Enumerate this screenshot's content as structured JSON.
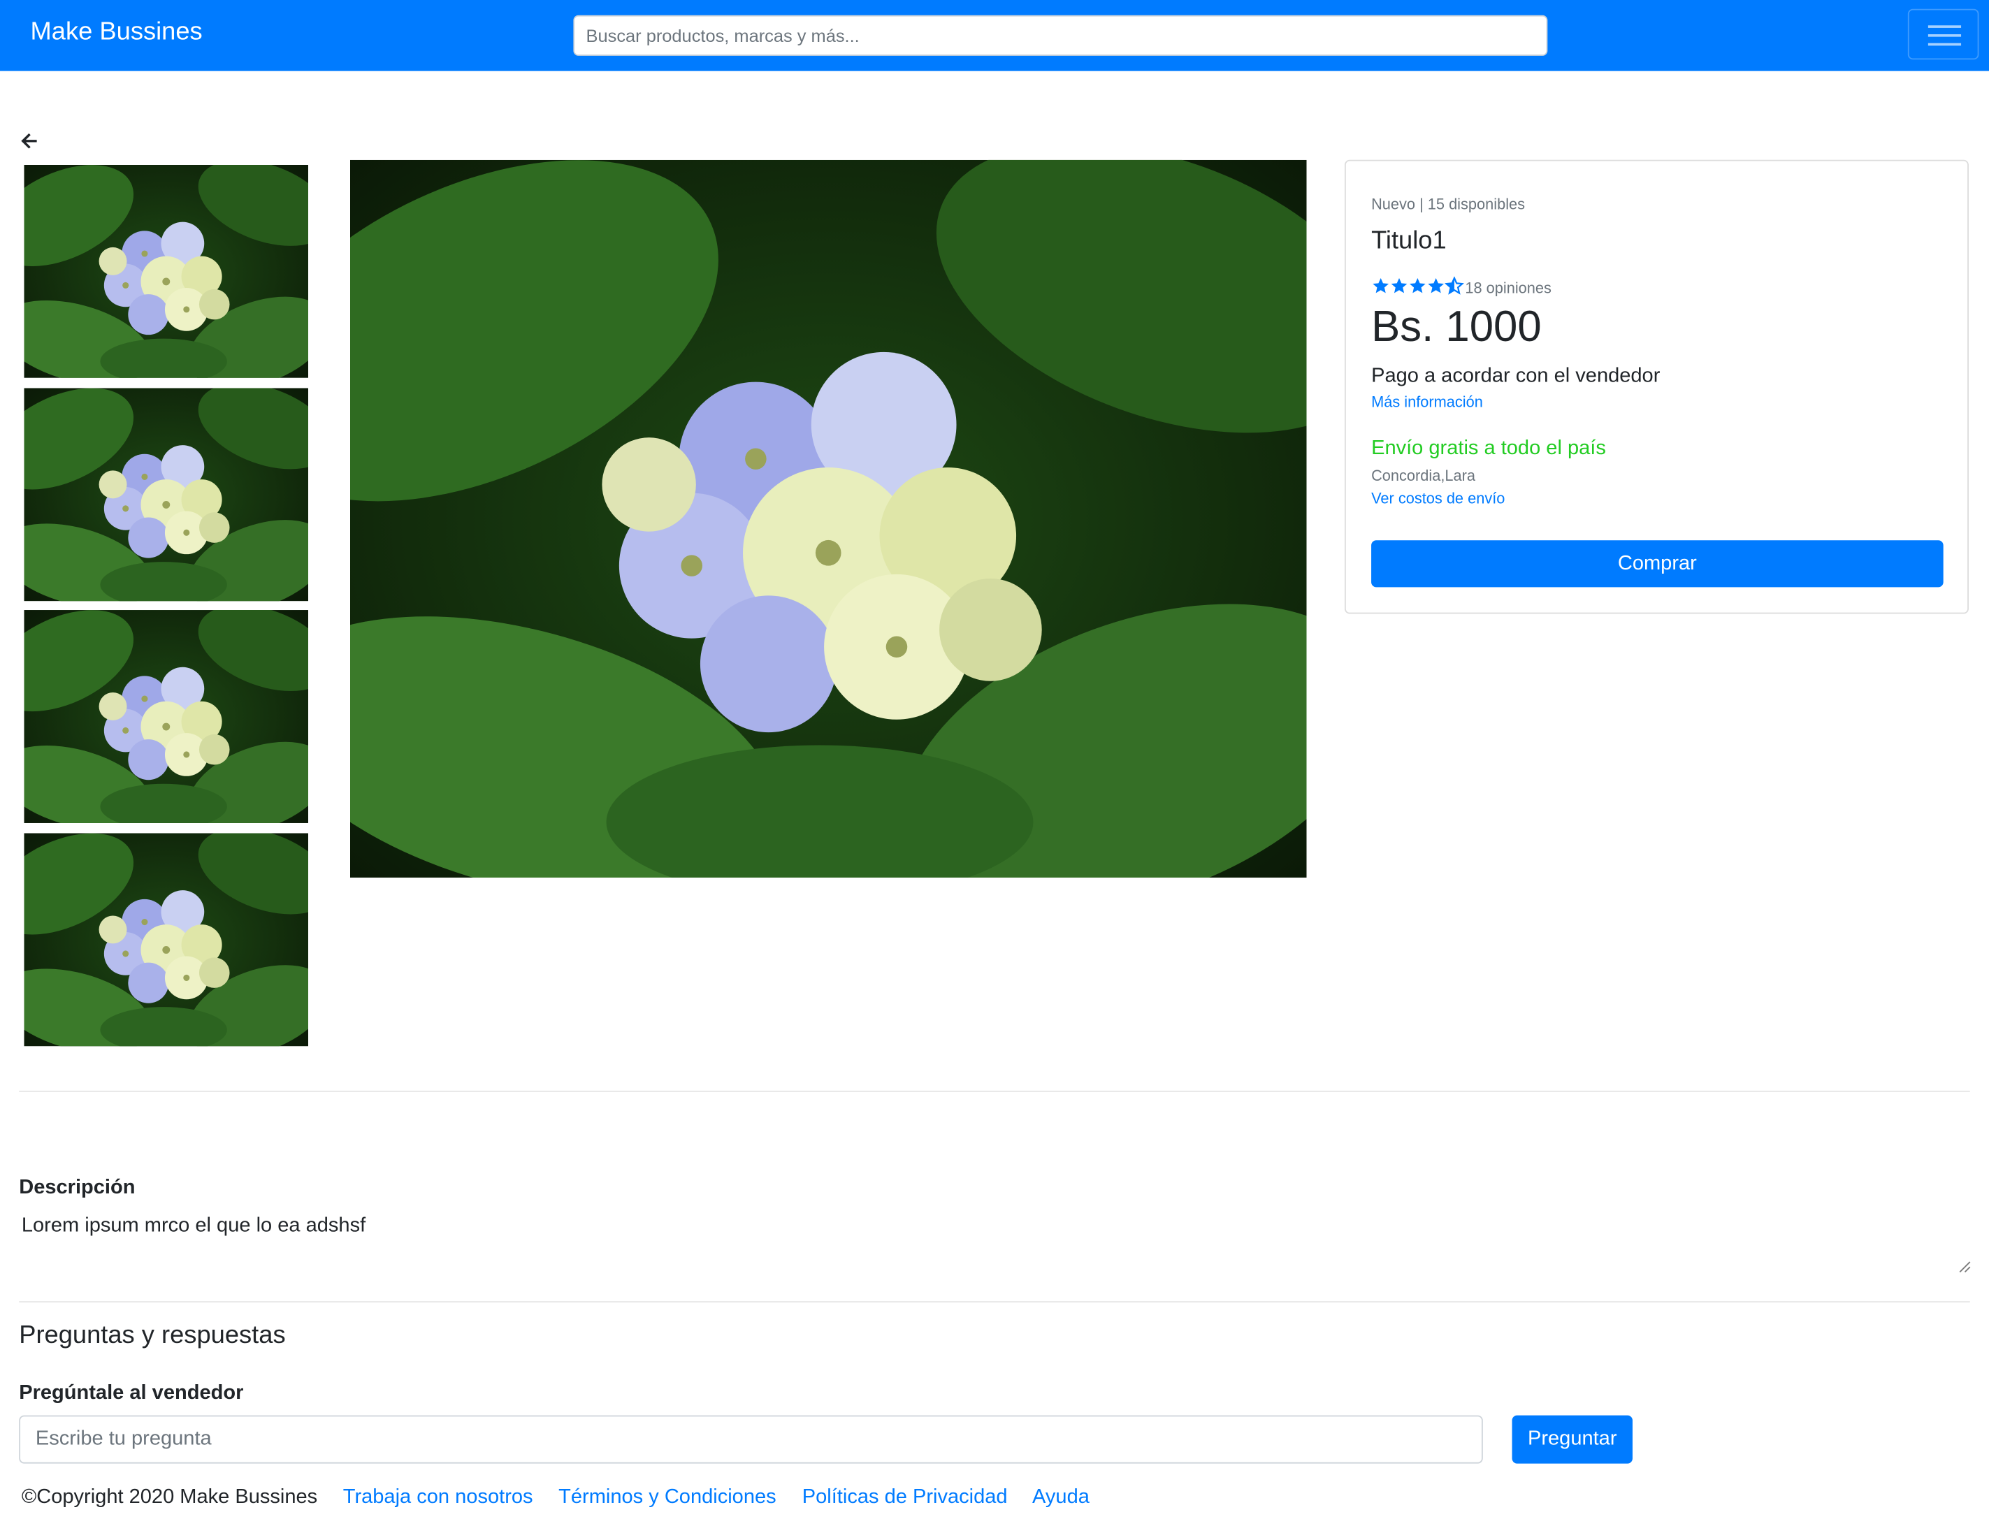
{
  "navbar": {
    "brand": "Make Bussines",
    "search_placeholder": "Buscar productos, marcas y más...",
    "menu_icon": "hamburger-icon",
    "color": "#007bff"
  },
  "back_icon": "arrow-left-icon",
  "gallery": {
    "thumbnails": [
      "flower-image",
      "flower-image",
      "flower-image",
      "flower-image"
    ],
    "main_image": "flower-image"
  },
  "product": {
    "condition": "Nuevo | 15 disponibles",
    "title": "Titulo1",
    "rating": 4.5,
    "rating_max": 5,
    "reviews": "18 opiniones",
    "price": "Bs. 1000",
    "payment": "Pago a acordar con el vendedor",
    "more_info": "Más información",
    "shipping": "Envío gratis a todo el país",
    "location": "Concordia,Lara",
    "shipping_costs": "Ver costos de envío",
    "buy_label": "Comprar",
    "shipping_color": "#22cc22"
  },
  "description": {
    "label": "Descripción",
    "text": "Lorem ipsum mrco el que lo ea adshsf"
  },
  "qa": {
    "title": "Preguntas y respuestas",
    "ask_label": "Pregúntale al vendedor",
    "ask_placeholder": "Escribe tu pregunta",
    "ask_button": "Preguntar"
  },
  "footer": {
    "copyright": "©Copyright 2020 Make Bussines",
    "links": [
      "Trabaja con nosotros",
      "Términos y Condiciones",
      "Políticas de Privacidad",
      "Ayuda"
    ]
  }
}
